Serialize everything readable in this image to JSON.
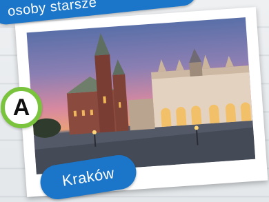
{
  "top_banner": {
    "text": "osoby starsze"
  },
  "badge": {
    "letter": "A"
  },
  "photo": {
    "caption": "Kraków"
  },
  "colors": {
    "banner": "#1b76c9",
    "badge_ring": "#79c33d"
  }
}
